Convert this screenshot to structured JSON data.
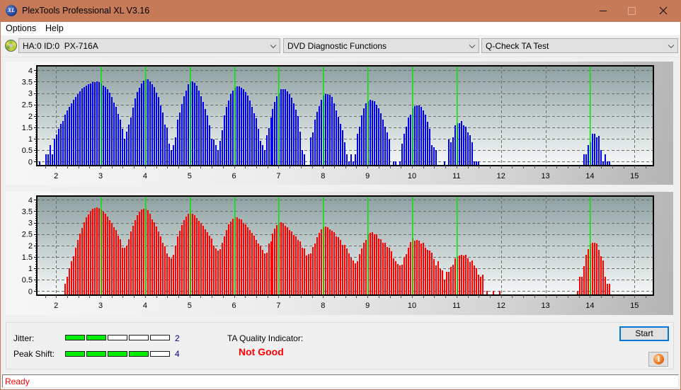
{
  "window": {
    "title": "PlexTools Professional XL V3.16",
    "logo_text": "XL",
    "icons": {
      "logo": "xl-logo-icon",
      "minimize": "minimize-icon",
      "maximize": "maximize-icon",
      "close": "close-icon"
    }
  },
  "menu": [
    {
      "label": "Options"
    },
    {
      "label": "Help"
    }
  ],
  "toolbar": {
    "drive_icon": "disc-drive-icon",
    "drive": "HA:0 ID:0  PX-716A",
    "function": "DVD Diagnostic Functions",
    "test": "Q-Check TA Test"
  },
  "chart_data": [
    {
      "type": "bar",
      "title": "",
      "xlabel": "",
      "ylabel": "",
      "legend": "none",
      "grid": true,
      "xlim": [
        1.567,
        15.425
      ],
      "ylim": [
        -0.177,
        4.195
      ],
      "xticks": [
        2,
        3,
        4,
        5,
        6,
        7,
        8,
        9,
        10,
        11,
        12,
        13,
        14,
        15
      ],
      "xtick_labels": [
        "2",
        "3",
        "4",
        "5",
        "6",
        "7",
        "8",
        "9",
        "10",
        "11",
        "12",
        "13",
        "14",
        "15"
      ],
      "x_minor_step": 0.25,
      "yticks": [
        0,
        0.5,
        1,
        1.5,
        2,
        2.5,
        3,
        3.5,
        4
      ],
      "ytick_labels": [
        "0",
        "0.5",
        "1",
        "1.5",
        "2",
        "2.5",
        "3",
        "3.5",
        "4"
      ],
      "markers": [
        3,
        4,
        5,
        6,
        7,
        8,
        9,
        10,
        11,
        14
      ],
      "marker_color": "#00e600",
      "series": [
        {
          "color": "#0000f0",
          "x_start": 1.635,
          "x_step": 0.047619,
          "values": [
            0,
            null,
            null,
            0.32,
            0.32,
            0.72,
            0.32,
            1.0,
            1.19,
            1.44,
            1.64,
            1.78,
            2.06,
            2.24,
            2.4,
            2.55,
            2.71,
            2.84,
            2.97,
            3.08,
            3.19,
            3.27,
            3.34,
            3.39,
            3.43,
            3.48,
            3.49,
            3.51,
            3.49,
            3.42,
            3.34,
            3.26,
            3.17,
            3.01,
            2.84,
            2.59,
            2.4,
            2.09,
            1.84,
            1.44,
            1.0,
            1.31,
            1.62,
            1.93,
            2.37,
            2.77,
            3.05,
            3.24,
            3.42,
            3.55,
            3.61,
            3.61,
            3.51,
            3.39,
            3.27,
            3.02,
            2.83,
            2.46,
            2.14,
            1.62,
            1.48,
            0.79,
            0.51,
            0.72,
            1.06,
            1.84,
            2.15,
            2.53,
            2.86,
            3.11,
            3.38,
            3.51,
            3.51,
            3.46,
            3.33,
            3.11,
            2.85,
            2.61,
            2.3,
            2.02,
            1.59,
            1.0,
            0.97,
            0.72,
            0.51,
            0.92,
            1.37,
            2.02,
            2.39,
            2.68,
            2.97,
            3.11,
            3.24,
            3.29,
            3.29,
            3.24,
            3.16,
            3.05,
            2.9,
            2.68,
            2.4,
            2.12,
            1.89,
            1.44,
            0.91,
            0.72,
            0.5,
            1.16,
            1.47,
            1.94,
            2.31,
            2.61,
            2.85,
            3.0,
            3.16,
            3.18,
            3.16,
            3.08,
            2.95,
            2.8,
            2.54,
            2.26,
            1.98,
            1.32,
            0.5,
            0.33,
            null,
            null,
            1.06,
            1.29,
            1.83,
            2.18,
            2.43,
            2.71,
            2.88,
            2.97,
            2.97,
            2.92,
            2.83,
            2.54,
            2.25,
            1.97,
            1.66,
            1.37,
            0.85,
            0.33,
            0,
            0.33,
            0,
            0.33,
            1.23,
            1.53,
            2.01,
            2.35,
            2.54,
            2.66,
            2.71,
            2.69,
            2.63,
            2.5,
            2.35,
            2.12,
            1.83,
            1.53,
            1.27,
            0.96,
            null,
            0,
            0,
            null,
            0,
            0.78,
            1.23,
            1.53,
            1.94,
            2.06,
            2.35,
            2.43,
            2.46,
            2.46,
            2.41,
            2.25,
            2.06,
            1.75,
            1.44,
            0.72,
            0.63,
            0.5,
            null,
            null,
            null,
            0,
            null,
            0.96,
            0.85,
            1.06,
            1.6,
            1.68,
            1.68,
            1.78,
            1.58,
            1.53,
            1.27,
            1.16,
            0.85,
            0,
            0,
            0,
            null,
            null,
            null,
            null,
            null,
            null,
            null,
            null,
            null,
            null,
            null,
            null,
            null,
            null,
            null,
            null,
            null,
            null,
            null,
            null,
            null,
            null,
            null,
            null,
            null,
            null,
            null,
            null,
            null,
            null,
            null,
            null,
            null,
            null,
            null,
            null,
            null,
            null,
            null,
            null,
            null,
            null,
            null,
            null,
            null,
            null,
            null,
            null,
            null,
            0.33,
            0.33,
            0.72,
            0.85,
            1.22,
            1.22,
            1.06,
            1.13,
            0.5,
            0,
            0.33,
            0,
            0
          ]
        }
      ]
    },
    {
      "type": "bar",
      "title": "",
      "xlabel": "",
      "ylabel": "",
      "legend": "none",
      "grid": true,
      "xlim": [
        1.567,
        15.425
      ],
      "ylim": [
        -0.177,
        4.164
      ],
      "xticks": [
        2,
        3,
        4,
        5,
        6,
        7,
        8,
        9,
        10,
        11,
        12,
        13,
        14,
        15
      ],
      "xtick_labels": [
        "2",
        "3",
        "4",
        "5",
        "6",
        "7",
        "8",
        "9",
        "10",
        "11",
        "12",
        "13",
        "14",
        "15"
      ],
      "x_minor_step": 0.25,
      "yticks": [
        0,
        0.5,
        1,
        1.5,
        2,
        2.5,
        3,
        3.5,
        4
      ],
      "ytick_labels": [
        "0",
        "0.5",
        "1",
        "1.5",
        "2",
        "2.5",
        "3",
        "3.5",
        "4"
      ],
      "markers": [
        3,
        4,
        5,
        6,
        7,
        8,
        9,
        10,
        11,
        14
      ],
      "marker_color": "#00e600",
      "series": [
        {
          "color": "#ff0000",
          "x_start": 1.635,
          "x_step": 0.047619,
          "values": [
            null,
            null,
            null,
            null,
            null,
            null,
            null,
            null,
            null,
            null,
            null,
            null,
            0.32,
            0.64,
            1.0,
            1.31,
            1.53,
            1.9,
            2.25,
            2.52,
            2.77,
            3.02,
            3.22,
            3.36,
            3.5,
            3.61,
            3.63,
            3.66,
            3.63,
            3.57,
            3.49,
            3.38,
            3.27,
            3.12,
            2.98,
            2.8,
            2.68,
            2.42,
            2.26,
            1.89,
            1.89,
            2.0,
            2.26,
            2.61,
            2.87,
            3.12,
            3.32,
            3.49,
            3.59,
            3.61,
            3.61,
            3.53,
            3.38,
            3.14,
            3.01,
            2.83,
            2.62,
            2.4,
            2.12,
            1.96,
            1.65,
            1.5,
            1.44,
            1.59,
            2.0,
            2.4,
            2.65,
            2.9,
            3.11,
            3.27,
            3.4,
            3.42,
            3.39,
            3.33,
            3.19,
            3.08,
            2.99,
            2.86,
            2.71,
            2.57,
            2.43,
            2.29,
            1.99,
            1.87,
            1.78,
            1.83,
            2.11,
            2.4,
            2.68,
            2.91,
            3.05,
            3.17,
            3.24,
            3.24,
            3.17,
            3.13,
            2.99,
            2.92,
            2.8,
            2.69,
            2.56,
            2.43,
            2.23,
            2.08,
            1.98,
            1.81,
            1.65,
            1.69,
            2.08,
            2.18,
            2.51,
            2.73,
            2.9,
            2.98,
            3.01,
            2.99,
            2.87,
            2.8,
            2.69,
            2.62,
            2.45,
            2.39,
            2.24,
            2.18,
            1.9,
            1.87,
            1.56,
            1.62,
            1.65,
            1.94,
            2.09,
            2.37,
            2.55,
            2.71,
            2.8,
            2.83,
            2.8,
            2.71,
            2.65,
            2.59,
            2.4,
            2.36,
            2.24,
            2.04,
            2.02,
            1.87,
            1.65,
            1.47,
            1.34,
            1.22,
            1.31,
            1.62,
            1.87,
            2.12,
            2.24,
            2.49,
            2.55,
            2.59,
            2.49,
            2.49,
            2.31,
            2.28,
            2.12,
            2.12,
            1.93,
            1.89,
            1.75,
            1.42,
            1.3,
            1.19,
            1.13,
            1.16,
            1.48,
            1.62,
            1.9,
            2.15,
            2.31,
            2.21,
            2.24,
            2.21,
            2.09,
            2.11,
            1.9,
            1.81,
            1.78,
            1.69,
            1.41,
            1.13,
            1.31,
            0.97,
            0.91,
            0.51,
            0.85,
            0.85,
            1.07,
            1.16,
            1.44,
            1.53,
            1.56,
            1.59,
            1.56,
            1.59,
            1.44,
            1.28,
            1.34,
            1.13,
            0.99,
            0.72,
            0.63,
            0.72,
            null,
            0,
            null,
            null,
            0,
            null,
            null,
            0,
            null,
            null,
            null,
            null,
            null,
            null,
            null,
            null,
            null,
            null,
            null,
            null,
            null,
            null,
            null,
            null,
            null,
            null,
            null,
            null,
            null,
            null,
            null,
            null,
            null,
            null,
            null,
            null,
            null,
            null,
            null,
            null,
            null,
            null,
            null,
            null,
            0,
            0.63,
            0.63,
            1.1,
            1.6,
            1.83,
            2.06,
            2.12,
            2.12,
            2.09,
            1.81,
            1.53,
            1.35,
            0.63,
            0.32,
            0.32
          ]
        }
      ]
    }
  ],
  "results": {
    "jitter": {
      "label": "Jitter:",
      "value": 2,
      "max": 5,
      "display": "2"
    },
    "peak_shift": {
      "label": "Peak Shift:",
      "value": 4,
      "max": 5,
      "display": "4"
    },
    "ta_quality": {
      "label": "TA Quality Indicator:",
      "value": "Not Good",
      "color": "#ff0000"
    },
    "meter_on_color": "#00ee00"
  },
  "buttons": {
    "start": "Start",
    "info_icon": "info-icon",
    "info_glyph": "i"
  },
  "status": {
    "text": "Ready",
    "color": "#ff0000"
  }
}
